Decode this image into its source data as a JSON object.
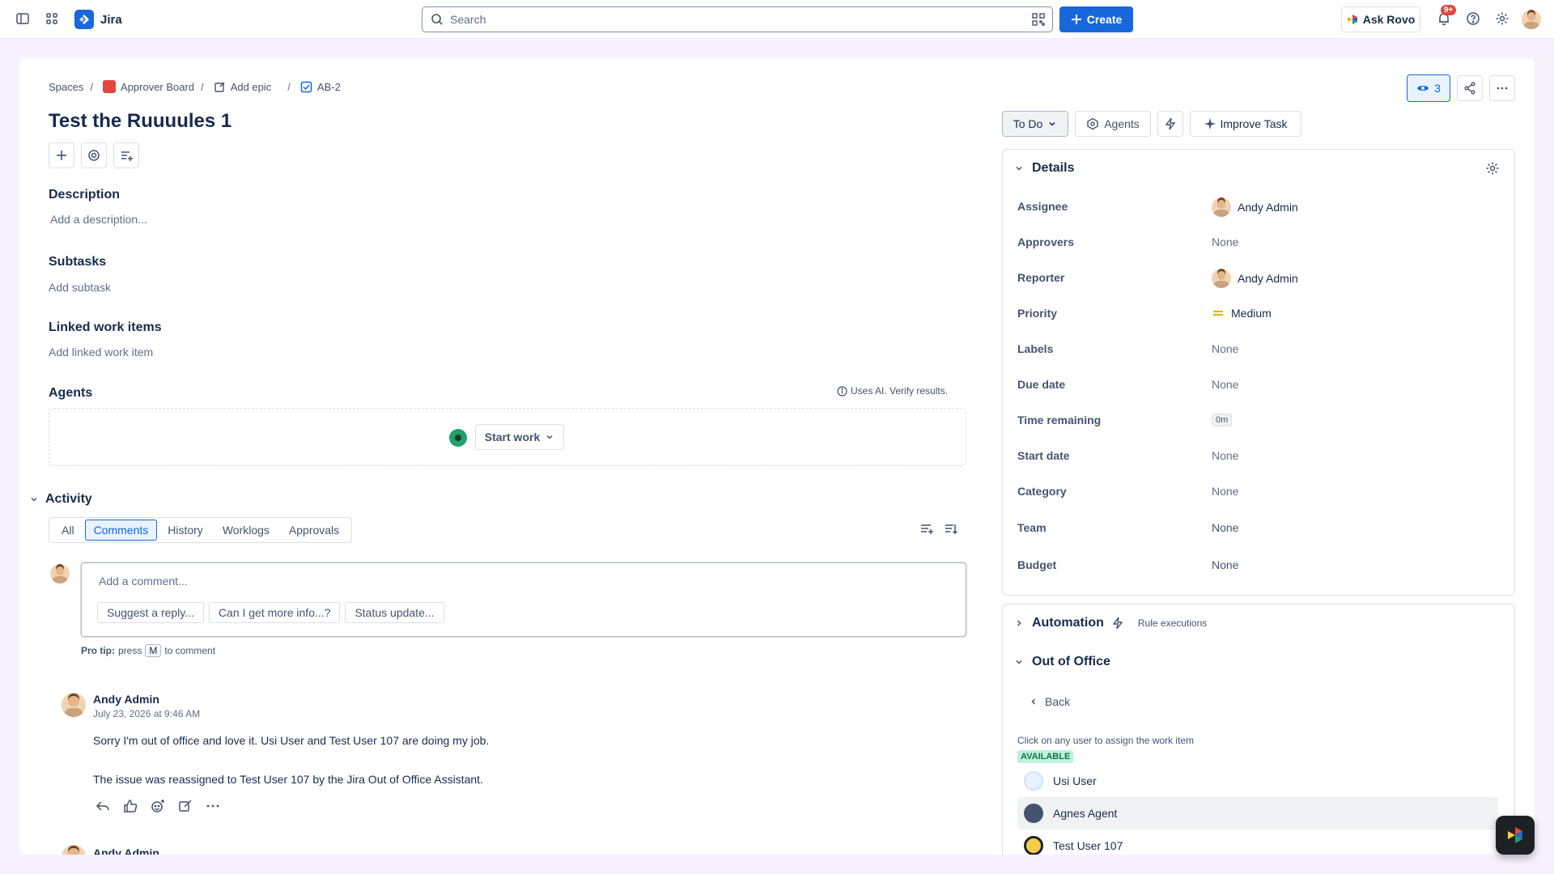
{
  "topbar": {
    "app_name": "Jira",
    "search_placeholder": "Search",
    "create_label": "Create",
    "ask_rovo_label": "Ask Rovo",
    "notification_badge": "9+"
  },
  "breadcrumb": {
    "spaces": "Spaces",
    "board": "Approver Board",
    "epic": "Add epic",
    "key": "AB-2"
  },
  "issue": {
    "title": "Test the Ruuuules 1",
    "description_heading": "Description",
    "description_placeholder": "Add a description...",
    "subtasks_heading": "Subtasks",
    "subtasks_action": "Add subtask",
    "linked_heading": "Linked work items",
    "linked_action": "Add linked work item",
    "agents_heading": "Agents",
    "ai_note": "Uses AI. Verify results.",
    "start_work_label": "Start work"
  },
  "activity": {
    "heading": "Activity",
    "tabs": [
      "All",
      "Comments",
      "History",
      "Worklogs",
      "Approvals"
    ],
    "selected_tab": "Comments",
    "comment_placeholder": "Add a comment...",
    "quick_replies": [
      "Suggest a reply...",
      "Can I get more info...?",
      "Status update..."
    ],
    "protip_bold": "Pro tip:",
    "protip_press": "press",
    "protip_key": "M",
    "protip_tail": "to comment",
    "comments": [
      {
        "author": "Andy Admin",
        "date": "July 23, 2026 at 9:46 AM",
        "line1": "Sorry I'm out of office and love it. Usi User and Test User 107 are doing my job.",
        "line2": "The issue was reassigned to Test User 107 by the Jira Out of Office Assistant."
      },
      {
        "author": "Andy Admin"
      }
    ]
  },
  "header_actions": {
    "watchers": "3",
    "status": "To Do",
    "agents_label": "Agents",
    "improve_label": "Improve Task"
  },
  "details": {
    "heading": "Details",
    "fields": [
      {
        "label": "Assignee",
        "value": "Andy Admin"
      },
      {
        "label": "Approvers",
        "value": "None"
      },
      {
        "label": "Reporter",
        "value": "Andy Admin"
      },
      {
        "label": "Priority",
        "value": "Medium"
      },
      {
        "label": "Labels",
        "value": "None"
      },
      {
        "label": "Due date",
        "value": "None"
      },
      {
        "label": "Time remaining",
        "value": "0m"
      },
      {
        "label": "Start date",
        "value": "None"
      },
      {
        "label": "Category",
        "value": "None"
      },
      {
        "label": "Team",
        "value": "None"
      },
      {
        "label": "Budget",
        "value": "None"
      }
    ]
  },
  "automation": {
    "heading": "Automation",
    "rule_executions": "Rule executions"
  },
  "out_of_office": {
    "heading": "Out of Office",
    "back_label": "Back",
    "instruction": "Click on any user to assign the work item",
    "available_label": "AVAILABLE",
    "users": [
      "Usi User",
      "Agnes Agent",
      "Test User 107"
    ]
  },
  "colors": {
    "brand": "#1868db",
    "page_bg": "#f7f2fd",
    "available_bg": "#baf3db",
    "priority_medium": "#e2b203"
  }
}
